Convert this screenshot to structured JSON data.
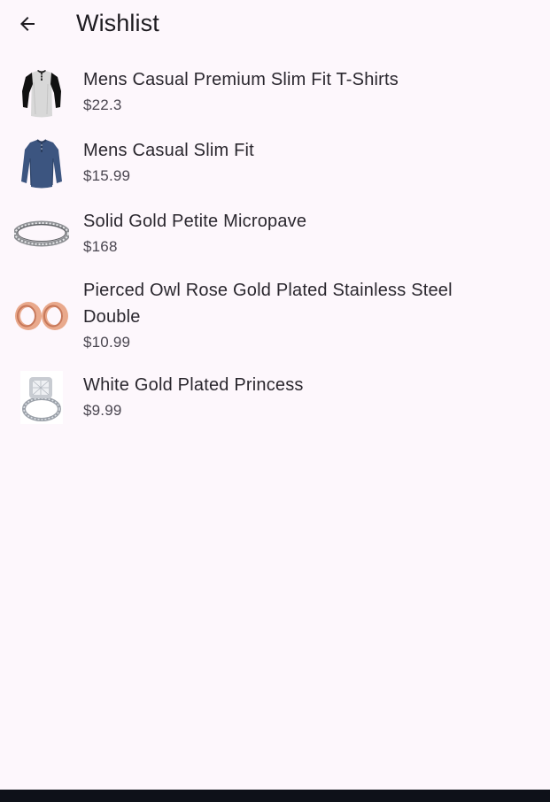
{
  "app_bar": {
    "title": "Wishlist",
    "back_icon": "arrow-back-icon"
  },
  "wishlist": {
    "items": [
      {
        "name": "Mens Casual Premium Slim Fit T-Shirts",
        "price": "$22.3",
        "image_icon": "raglan-tshirt-image"
      },
      {
        "name": "Mens Casual Slim Fit",
        "price": "$15.99",
        "image_icon": "long-sleeve-shirt-image"
      },
      {
        "name": "Solid Gold Petite Micropave",
        "price": "$168",
        "image_icon": "bracelet-image"
      },
      {
        "name": "Pierced Owl Rose Gold Plated Stainless Steel Double",
        "price": "$10.99",
        "image_icon": "rose-gold-plugs-image"
      },
      {
        "name": "White Gold Plated Princess",
        "price": "$9.99",
        "image_icon": "diamond-ring-image"
      }
    ]
  },
  "colors": {
    "background": "#fdf7fc",
    "text_primary": "#1d1b20",
    "text_secondary": "#4a4650",
    "nav_bar": "#0e1119"
  }
}
